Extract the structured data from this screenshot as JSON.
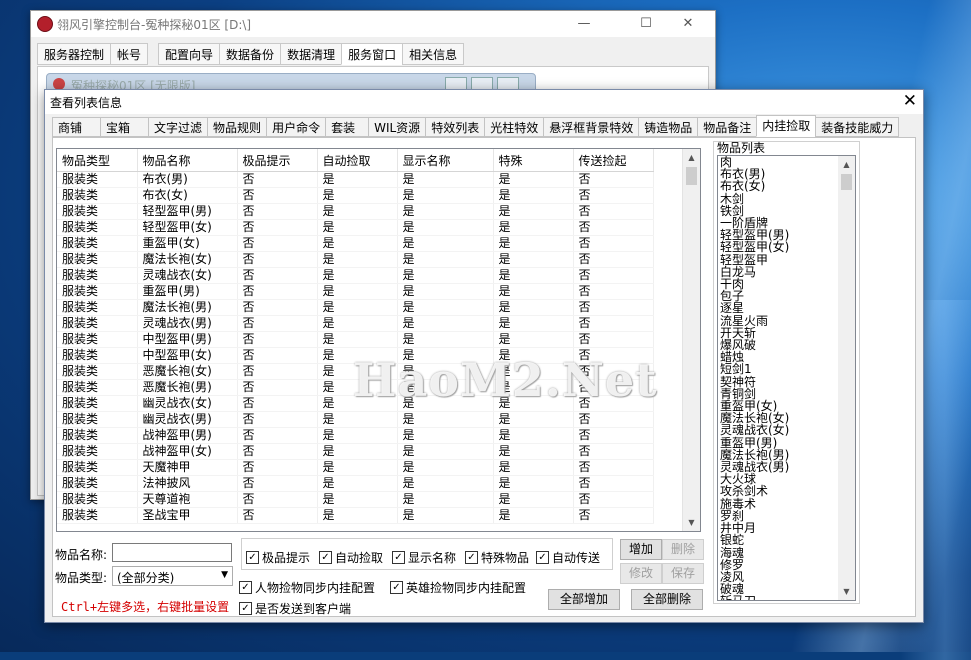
{
  "back_window": {
    "title": "翎风引擎控制台-冤种探秘01区 [D:\\]",
    "controls": [
      "—",
      "☐",
      "✕"
    ],
    "menu": [
      "服务器控制",
      "帐号",
      "配置向导",
      "数据备份",
      "数据清理",
      "服务窗口",
      "相关信息"
    ],
    "active_menu": "服务窗口",
    "inner_title": "冤种探秘01区 [无限版]"
  },
  "dialog": {
    "title": "查看列表信息",
    "close": "✕",
    "tabs": [
      "商铺",
      "宝箱",
      "文字过滤",
      "物品规则",
      "用户命令",
      "套装",
      "WIL资源",
      "特效列表",
      "光柱特效",
      "悬浮框背景特效",
      "铸造物品",
      "物品备注",
      "内挂捡取",
      "装备技能威力"
    ],
    "active_tab": "内挂捡取"
  },
  "table": {
    "columns": [
      "物品类型",
      "物品名称",
      "极品提示",
      "自动捡取",
      "显示名称",
      "特殊",
      "传送捡起"
    ],
    "rows": [
      [
        "服装类",
        "布衣(男)",
        "否",
        "是",
        "是",
        "是",
        "否"
      ],
      [
        "服装类",
        "布衣(女)",
        "否",
        "是",
        "是",
        "是",
        "否"
      ],
      [
        "服装类",
        "轻型盔甲(男)",
        "否",
        "是",
        "是",
        "是",
        "否"
      ],
      [
        "服装类",
        "轻型盔甲(女)",
        "否",
        "是",
        "是",
        "是",
        "否"
      ],
      [
        "服装类",
        "重盔甲(女)",
        "否",
        "是",
        "是",
        "是",
        "否"
      ],
      [
        "服装类",
        "魔法长袍(女)",
        "否",
        "是",
        "是",
        "是",
        "否"
      ],
      [
        "服装类",
        "灵魂战衣(女)",
        "否",
        "是",
        "是",
        "是",
        "否"
      ],
      [
        "服装类",
        "重盔甲(男)",
        "否",
        "是",
        "是",
        "是",
        "否"
      ],
      [
        "服装类",
        "魔法长袍(男)",
        "否",
        "是",
        "是",
        "是",
        "否"
      ],
      [
        "服装类",
        "灵魂战衣(男)",
        "否",
        "是",
        "是",
        "是",
        "否"
      ],
      [
        "服装类",
        "中型盔甲(男)",
        "否",
        "是",
        "是",
        "是",
        "否"
      ],
      [
        "服装类",
        "中型盔甲(女)",
        "否",
        "是",
        "是",
        "是",
        "否"
      ],
      [
        "服装类",
        "恶魔长袍(女)",
        "否",
        "是",
        "是",
        "是",
        "否"
      ],
      [
        "服装类",
        "恶魔长袍(男)",
        "否",
        "是",
        "是",
        "是",
        "否"
      ],
      [
        "服装类",
        "幽灵战衣(女)",
        "否",
        "是",
        "是",
        "是",
        "否"
      ],
      [
        "服装类",
        "幽灵战衣(男)",
        "否",
        "是",
        "是",
        "是",
        "否"
      ],
      [
        "服装类",
        "战神盔甲(男)",
        "否",
        "是",
        "是",
        "是",
        "否"
      ],
      [
        "服装类",
        "战神盔甲(女)",
        "否",
        "是",
        "是",
        "是",
        "否"
      ],
      [
        "服装类",
        "天魔神甲",
        "否",
        "是",
        "是",
        "是",
        "否"
      ],
      [
        "服装类",
        "法神披风",
        "否",
        "是",
        "是",
        "是",
        "否"
      ],
      [
        "服装类",
        "天尊道袍",
        "否",
        "是",
        "是",
        "是",
        "否"
      ],
      [
        "服装类",
        "圣战宝甲",
        "否",
        "是",
        "是",
        "是",
        "否"
      ]
    ]
  },
  "watermark": "HaoM2.Net",
  "item_list": {
    "label": "物品列表",
    "items": [
      "肉",
      "布衣(男)",
      "布衣(女)",
      "木剑",
      "铁剑",
      "一阶盾牌",
      "轻型盔甲(男)",
      "轻型盔甲(女)",
      "轻型盔甲",
      "白龙马",
      "干肉",
      "包子",
      "逐星",
      "流星火雨",
      "开天斩",
      "爆风破",
      "蜡烛",
      "短剑1",
      "契神符",
      "青铜剑",
      "重盔甲(女)",
      "魔法长袍(女)",
      "灵魂战衣(女)",
      "重盔甲(男)",
      "魔法长袍(男)",
      "灵魂战衣(男)",
      "大火球",
      "攻杀剑术",
      "施毒术",
      "罗刹",
      "井中月",
      "银蛇",
      "海魂",
      "修罗",
      "凌风",
      "破魂",
      "斩马刀"
    ]
  },
  "form": {
    "name_label": "物品名称:",
    "name_value": "",
    "type_label": "物品类型:",
    "type_value": "(全部分类)",
    "checkboxes_row1": [
      {
        "label": "极品提示",
        "checked": true
      },
      {
        "label": "自动捡取",
        "checked": true
      },
      {
        "label": "显示名称",
        "checked": true
      },
      {
        "label": "特殊物品",
        "checked": true
      },
      {
        "label": "自动传送",
        "checked": true
      }
    ],
    "sync_player": {
      "label": "人物捡物同步内挂配置",
      "checked": true
    },
    "sync_hero": {
      "label": "英雄捡物同步内挂配置",
      "checked": true
    },
    "send_client": {
      "label": "是否发送到客户端",
      "checked": true
    },
    "hint": "Ctrl+左键多选，右键批量设置"
  },
  "buttons": {
    "add": "增加",
    "delete": "删除",
    "modify": "修改",
    "save": "保存",
    "add_all": "全部增加",
    "delete_all": "全部删除"
  },
  "check_mark": "✓"
}
